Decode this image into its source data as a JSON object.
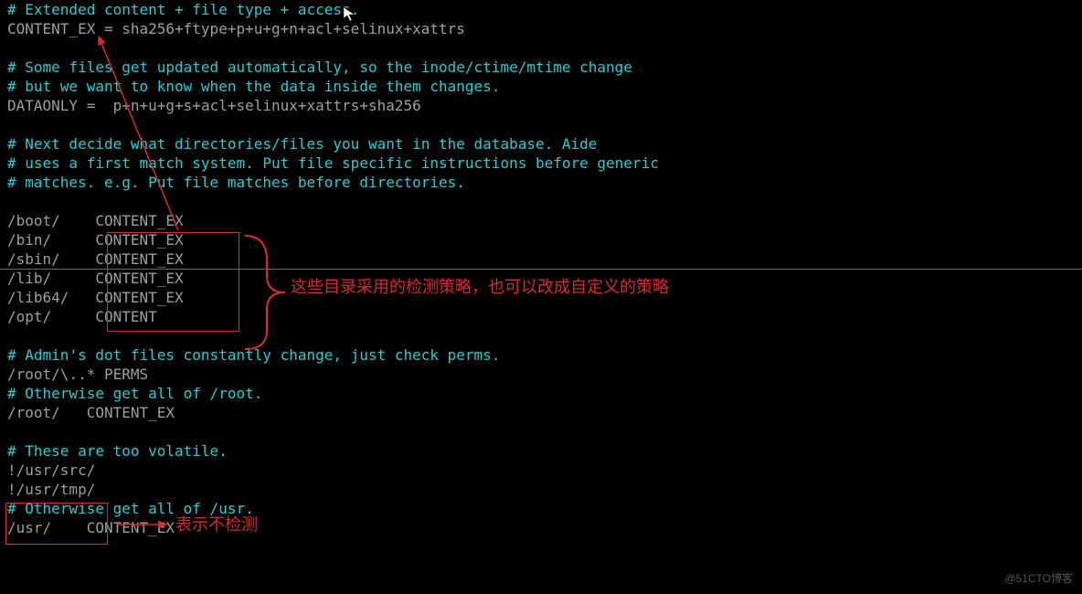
{
  "comments": {
    "c1": "# Extended content + file type + access.",
    "c2": "# Some files get updated automatically, so the inode/ctime/mtime change",
    "c3": "# but we want to know when the data inside them changes.",
    "c4": "# Next decide what directories/files you want in the database. Aide",
    "c5": "# uses a first match system. Put file specific instructions before generic",
    "c6": "# matches. e.g. Put file matches before directories.",
    "c7": "# Admin's dot files constantly change, just check perms.",
    "c8": "# Otherwise get all of /root.",
    "c9": "# These are too volatile.",
    "c10": "# Otherwise get all of /usr."
  },
  "defs": {
    "content_ex": "CONTENT_EX = sha256+ftype+p+u+g+n+acl+selinux+xattrs",
    "dataonly_pre": "DATAONLY = ",
    "dataonly_vals": "p+n+u+g+s+acl+selinux+xattrs+sha256"
  },
  "rules": {
    "boot": "/boot/    CONTENT_EX",
    "bin": "/bin/     CONTENT_EX",
    "sbin": "/sbin/    CONTENT_EX",
    "lib": "/lib/     CONTENT_EX",
    "lib64": "/lib64/   CONTENT_EX",
    "opt": "/opt/     CONTENT",
    "root_dot": "/root/\\..* PERMS",
    "root": "/root/   CONTENT_EX",
    "not_usr_src": "!/usr/src/",
    "not_usr_tmp": "!/usr/tmp/",
    "usr": "/usr/    CONTENT_EX"
  },
  "annotations": {
    "strategy": "这些目录采用的检测策略，也可以改成自定义的策略",
    "nocheck": "表示不检测"
  },
  "watermark": "@51CTO博客",
  "colors": {
    "bg": "#000000",
    "comment": "#2bcccf",
    "dim": "#9aa0a0",
    "red": "#d92c2c"
  }
}
